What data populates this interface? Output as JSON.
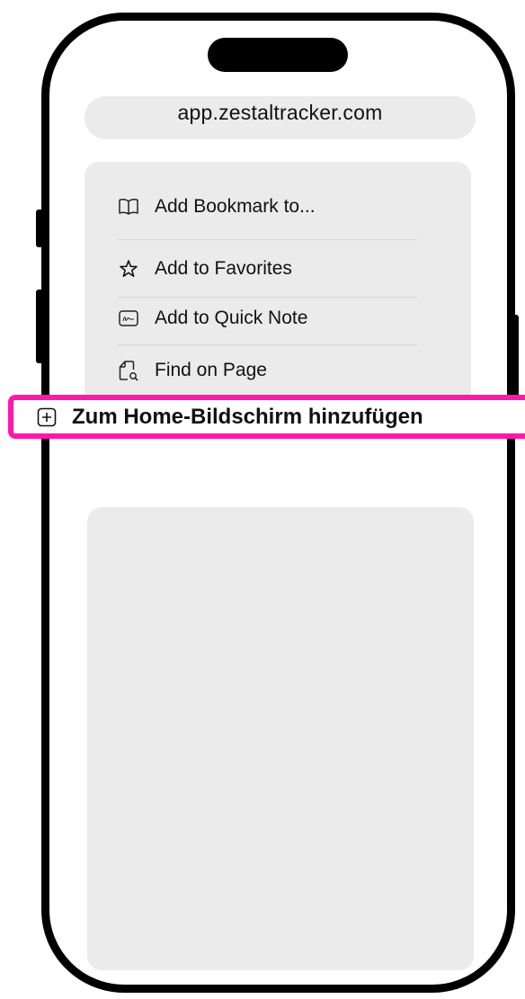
{
  "browser": {
    "url": "app.zestaltracker.com"
  },
  "share_menu": {
    "items": [
      {
        "label": "Add Bookmark to...",
        "icon": "book-icon"
      },
      {
        "label": "Add to Favorites",
        "icon": "star-icon"
      },
      {
        "label": "Add to Quick Note",
        "icon": "quick-note-icon"
      },
      {
        "label": "Find on Page",
        "icon": "find-on-page-icon"
      }
    ],
    "highlighted_item": {
      "label": "Zum Home-Bildschirm hinzufügen",
      "icon": "plus-square-icon"
    }
  },
  "colors": {
    "highlight": "#ff19a8",
    "card": "#ebebeb",
    "phone_frame": "#000000"
  }
}
